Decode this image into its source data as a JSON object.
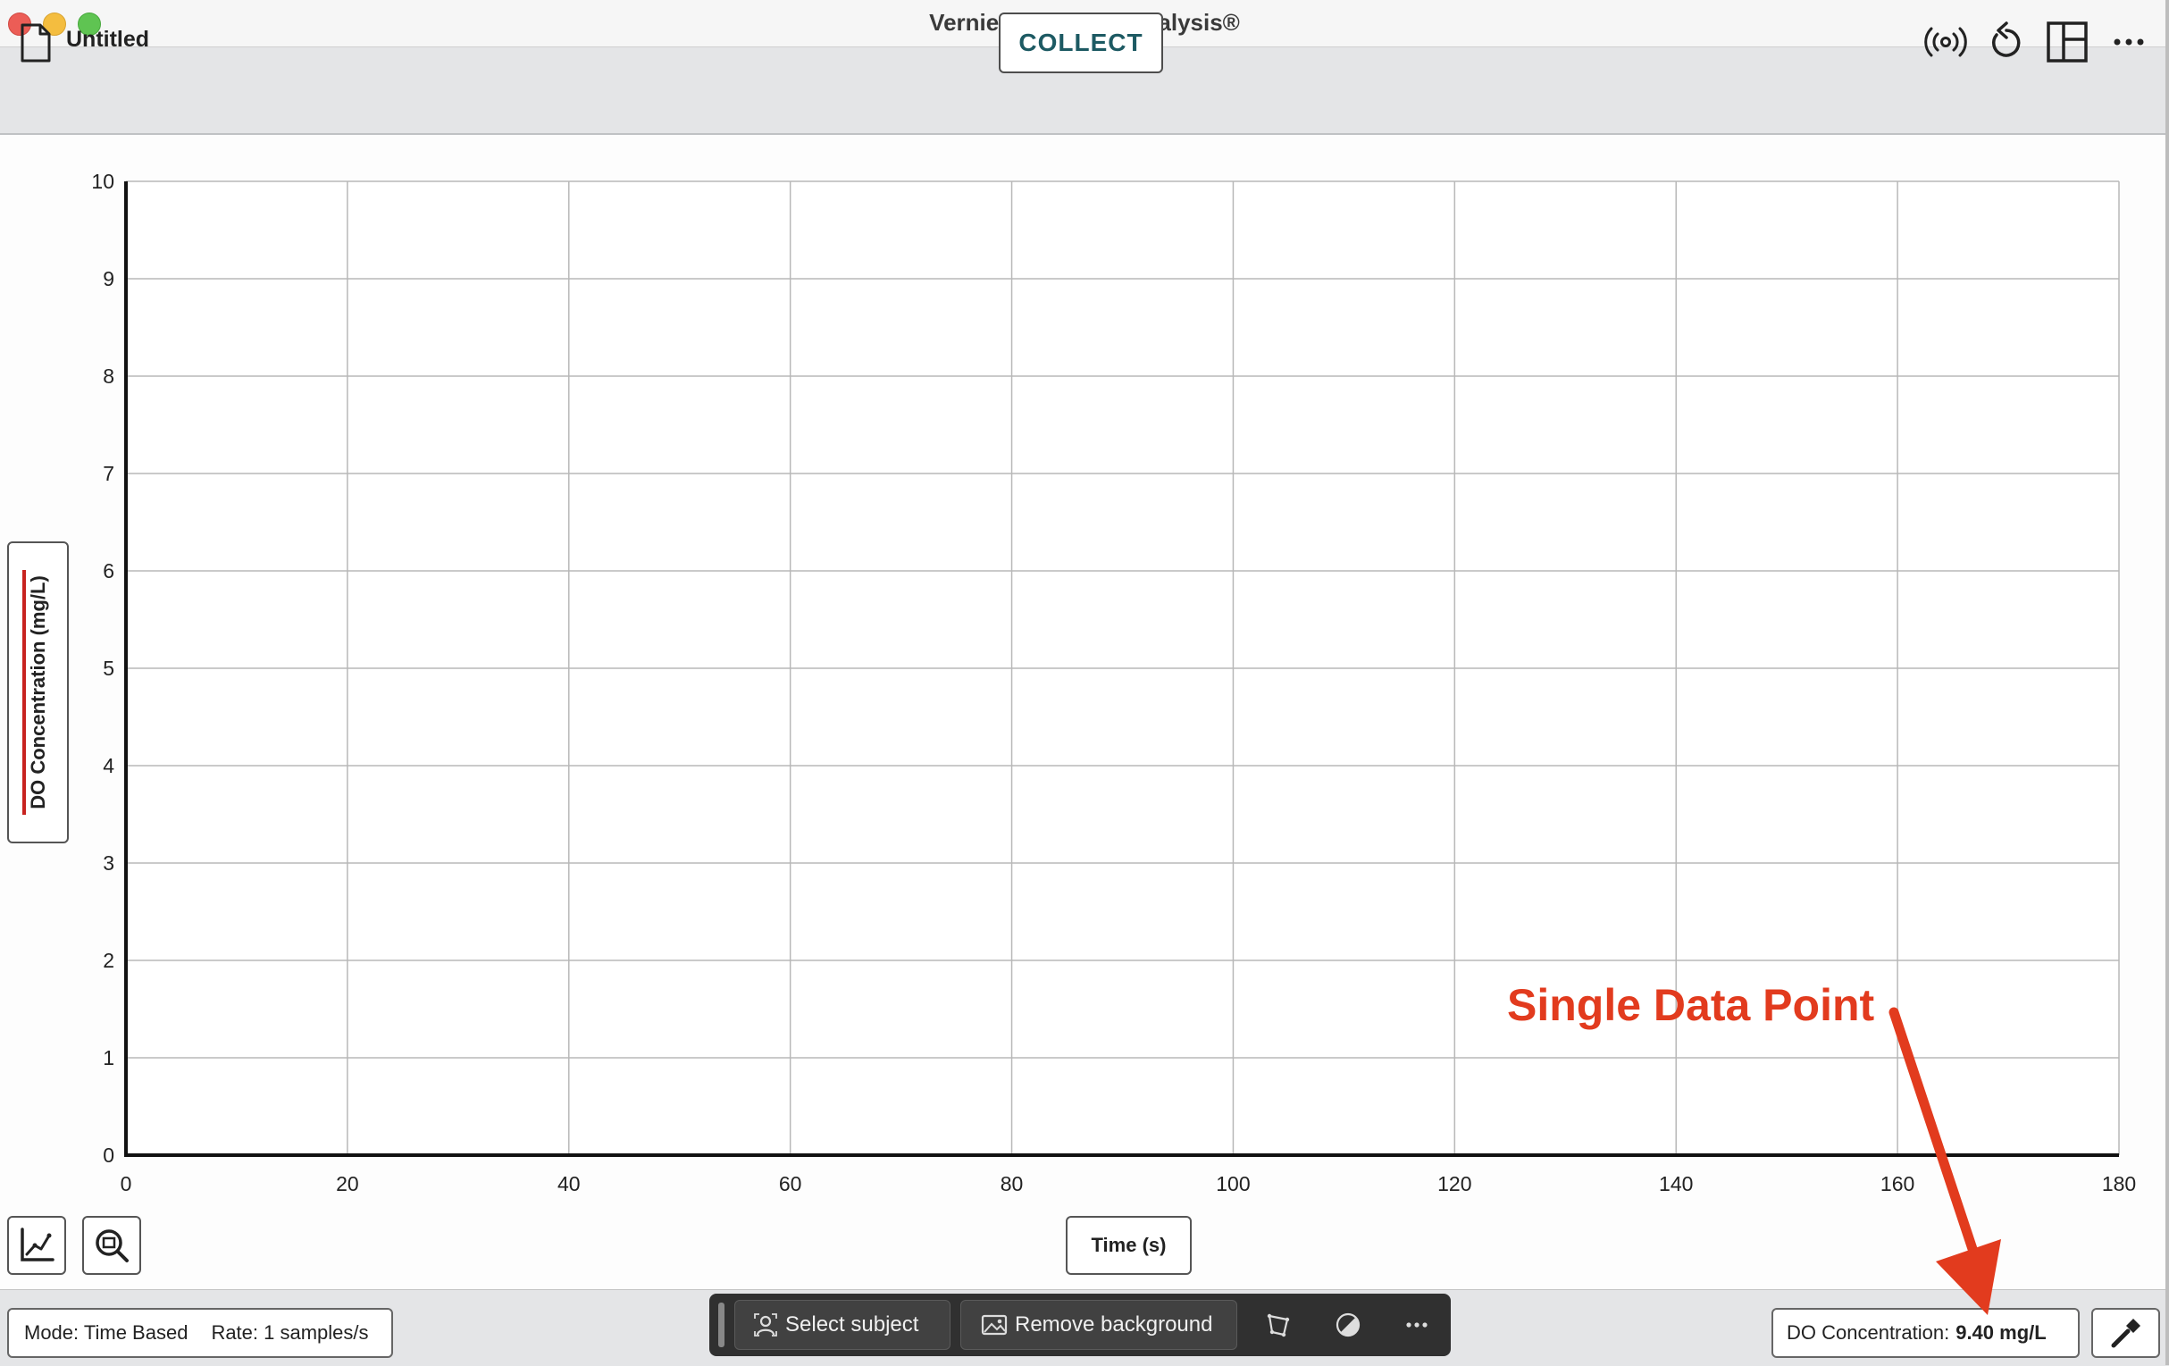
{
  "window": {
    "title": "Vernier Graphical Analysis®"
  },
  "toolbar": {
    "document_title": "Untitled",
    "collect_label": "COLLECT",
    "icons": [
      "wireless-sensor-icon",
      "undo-icon",
      "layout-icon",
      "more-icon"
    ]
  },
  "graph": {
    "y_axis_label": "DO Concentration (mg/L)",
    "x_axis_label": "Time (s)",
    "series_color": "#c8231f"
  },
  "chart_data": {
    "type": "line",
    "title": "",
    "xlabel": "Time (s)",
    "ylabel": "DO Concentration (mg/L)",
    "xlim": [
      0,
      180
    ],
    "ylim": [
      0,
      10
    ],
    "xticks": [
      0,
      20,
      40,
      60,
      80,
      100,
      120,
      140,
      160,
      180
    ],
    "yticks": [
      0,
      1,
      2,
      3,
      4,
      5,
      6,
      7,
      8,
      9,
      10
    ],
    "grid": true,
    "series": []
  },
  "status": {
    "mode": "Mode: Time Based",
    "rate": "Rate: 1 samples/s",
    "reading_label": "DO Concentration:",
    "reading_value": "9.40 mg/L"
  },
  "floating_toolbar": {
    "select_subject": "Select subject",
    "remove_background": "Remove background"
  },
  "annotation": {
    "text": "Single Data Point",
    "color": "#e23b1e"
  }
}
